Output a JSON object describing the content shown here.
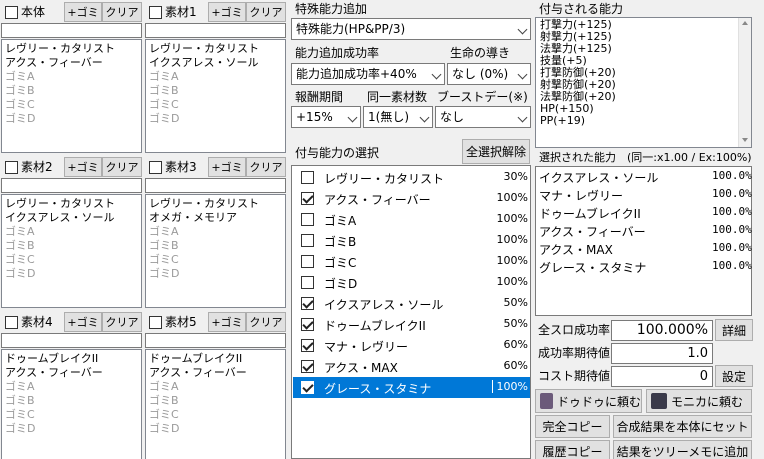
{
  "panels": [
    {
      "label": "本体",
      "items": [
        "レヴリー・カタリスト",
        "アクス・フィーバー"
      ],
      "trash": [
        "ゴミA",
        "ゴミB",
        "ゴミC",
        "ゴミD"
      ]
    },
    {
      "label": "素材1",
      "items": [
        "レヴリー・カタリスト",
        "イクスアレス・ソール"
      ],
      "trash": [
        "ゴミA",
        "ゴミB",
        "ゴミC",
        "ゴミD"
      ]
    },
    {
      "label": "素材2",
      "items": [
        "レヴリー・カタリスト",
        "イクスアレス・ソール"
      ],
      "trash": [
        "ゴミA",
        "ゴミB",
        "ゴミC",
        "ゴミD"
      ]
    },
    {
      "label": "素材3",
      "items": [
        "レヴリー・カタリスト",
        "オメガ・メモリア"
      ],
      "trash": [
        "ゴミA",
        "ゴミB",
        "ゴミC",
        "ゴミD"
      ]
    },
    {
      "label": "素材4",
      "items": [
        "ドゥームブレイクII",
        "アクス・フィーバー"
      ],
      "trash": [
        "ゴミA",
        "ゴミB",
        "ゴミC",
        "ゴミD"
      ]
    },
    {
      "label": "素材5",
      "items": [
        "ドゥームブレイクII",
        "アクス・フィーバー"
      ],
      "trash": [
        "ゴミA",
        "ゴミB",
        "ゴミC",
        "ゴミD"
      ]
    }
  ],
  "panel_buttons": {
    "trash": "+ゴミ",
    "clear": "クリア"
  },
  "special": {
    "label": "特殊能力追加",
    "value": "特殊能力(HP&PP/3)"
  },
  "success": {
    "label": "能力追加成功率",
    "value": "能力追加成功率+40%"
  },
  "life": {
    "label": "生命の導き",
    "value": "なし (0%)"
  },
  "reward": {
    "label": "報酬期間",
    "value": "+15%"
  },
  "same": {
    "label": "同一素材数",
    "value": "1(無し)"
  },
  "boost": {
    "label": "ブーストデー(※)",
    "value": "なし"
  },
  "grant_select": {
    "label": "付与能力の選択",
    "clear_all": "全選択解除"
  },
  "abilities": [
    {
      "name": "レヴリー・カタリスト",
      "pct": "30%",
      "checked": false
    },
    {
      "name": "アクス・フィーバー",
      "pct": "100%",
      "checked": true
    },
    {
      "name": "ゴミA",
      "pct": "100%",
      "checked": false
    },
    {
      "name": "ゴミB",
      "pct": "100%",
      "checked": false
    },
    {
      "name": "ゴミC",
      "pct": "100%",
      "checked": false
    },
    {
      "name": "ゴミD",
      "pct": "100%",
      "checked": false
    },
    {
      "name": "イクスアレス・ソール",
      "pct": "50%",
      "checked": true
    },
    {
      "name": "ドゥームブレイクII",
      "pct": "50%",
      "checked": true
    },
    {
      "name": "マナ・レヴリー",
      "pct": "60%",
      "checked": true
    },
    {
      "name": "アクス・MAX",
      "pct": "60%",
      "checked": true
    },
    {
      "name": "グレース・スタミナ",
      "pct": "100%",
      "checked": true,
      "highlight": true
    }
  ],
  "granted": {
    "label": "付与される能力",
    "items": [
      "打撃力(+125)",
      "射撃力(+125)",
      "法撃力(+125)",
      "技量(+5)",
      "打撃防御(+20)",
      "射撃防御(+20)",
      "法撃防御(+20)",
      "HP(+150)",
      "PP(+19)"
    ]
  },
  "selected": {
    "label": "選択された能力　(同一:x1.00 / Ex:100%)",
    "items": [
      {
        "name": "イクスアレス・ソール",
        "pct": "100.0%"
      },
      {
        "name": "マナ・レヴリー",
        "pct": "100.0%"
      },
      {
        "name": "ドゥームブレイクII",
        "pct": "100.0%"
      },
      {
        "name": "アクス・フィーバー",
        "pct": "100.0%"
      },
      {
        "name": "アクス・MAX",
        "pct": "100.0%"
      },
      {
        "name": "グレース・スタミナ",
        "pct": "100.0%"
      }
    ]
  },
  "stats": {
    "all_rate_label": "全スロ成功率",
    "all_rate": "100.000%",
    "detail": "詳細",
    "exp_label": "成功率期待値",
    "exp": "1.0",
    "cost_label": "コスト期待値",
    "cost": "0",
    "setting": "設定"
  },
  "actions": {
    "dudu": "ドゥドゥに頼む",
    "monica": "モニカに頼む",
    "copy_all": "完全コピー",
    "set_result": "合成結果を本体にセット",
    "copy_history": "履歴コピー",
    "tree_memo": "結果をツリーメモに追加"
  },
  "colors": {
    "highlight": "#0078d7"
  }
}
